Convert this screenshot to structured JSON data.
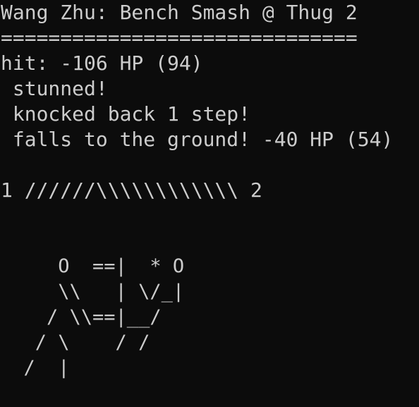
{
  "window": {
    "title": "Wang Zhu: Bench Smash @ Thug 2",
    "rule": "=============================="
  },
  "log": {
    "hit": "hit: -106 HP (94)",
    "effect_1": " stunned!",
    "effect_2": " knocked back 1 step!",
    "effect_3": " falls to the ground! -40 HP (54)"
  },
  "distance_bar": {
    "text": "1 //////\\\\\\\\\\\\\\\\\\\\\\\\ 2",
    "player_left": "1",
    "player_right": "2"
  },
  "ascii_art": {
    "line_1": "     O  ==|  * O",
    "line_2": "     \\\\   | \\/_|",
    "line_3": "    / \\\\==|__/",
    "line_4": "   / \\    / /",
    "line_5": "  /  |"
  },
  "colors": {
    "background": "#0c0c0c",
    "foreground": "#cccccc"
  }
}
